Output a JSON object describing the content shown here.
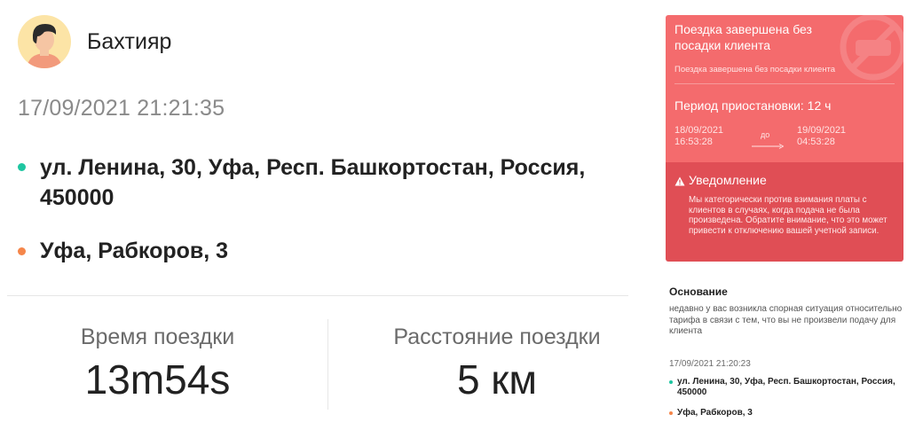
{
  "user": {
    "name": "Бахтияр",
    "avatar_icon": "user-avatar-icon"
  },
  "trip": {
    "datetime": "17/09/2021 21:21:35",
    "pickup": "ул. Ленина, 30, Уфа, Респ. Башкортостан, Россия, 450000",
    "dropoff": "Уфа, Рабкоров, 3",
    "duration_label": "Время поездки",
    "duration_value": "13m54s",
    "distance_label": "Расстояние поездки",
    "distance_value": "5 км"
  },
  "alert": {
    "title": "Поездка завершена без посадки клиента",
    "subtitle": "Поездка завершена без посадки клиента",
    "period": "Период приостановки: 12 ч",
    "from": [
      "18/09/2021",
      "16:53:28"
    ],
    "to_label": "до",
    "to": [
      "19/09/2021",
      "04:53:28"
    ],
    "notice_title": "Уведомление",
    "notice_text": "Мы категорически против взимания платы с клиентов в случаях, когда подача не была произведена. Обратите внимание, что это может привести к отключению вашей учетной записи."
  },
  "basis": {
    "title": "Основание",
    "text": "недавно у вас возникла спорная ситуация относительно тарифа в связи с тем, что вы не произвели подачу для клиента",
    "datetime": "17/09/2021 21:20:23",
    "pickup": "ул. Ленина, 30, Уфа, Респ. Башкортостан, Россия, 450000",
    "dropoff": "Уфа, Рабкоров, 3"
  },
  "colors": {
    "pickup_dot": "#1fc6a1",
    "dropoff_dot": "#f5864a",
    "alert_top": "#f46b6d",
    "alert_bottom": "#e04e55"
  }
}
